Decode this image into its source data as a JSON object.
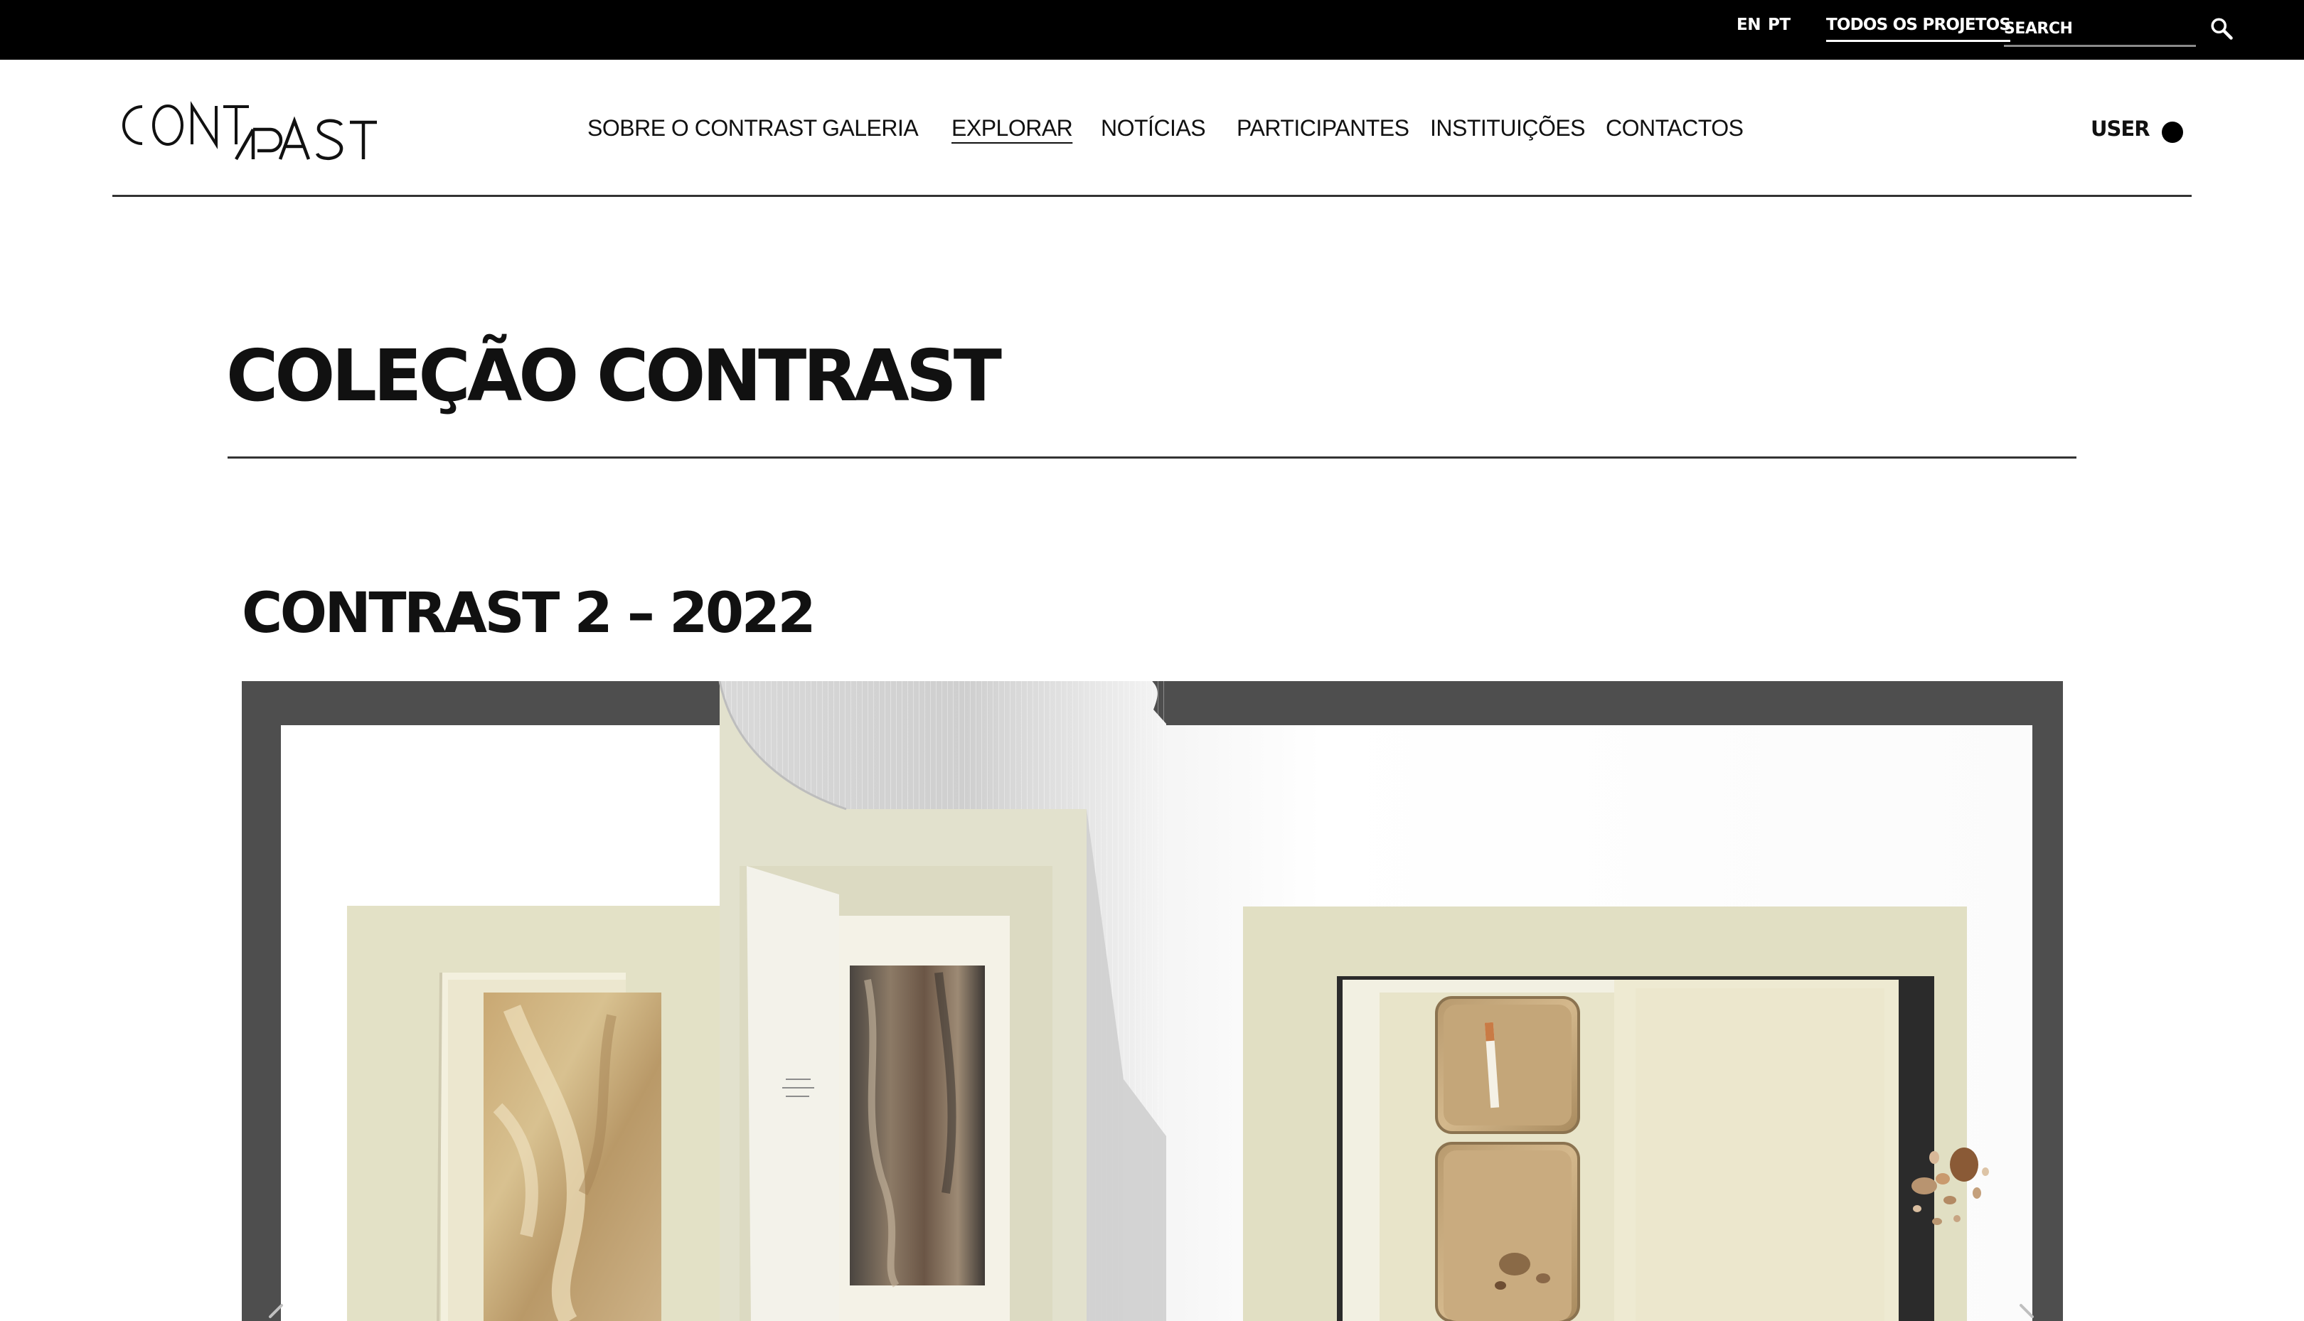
{
  "topbar": {
    "lang_en": "EN",
    "lang_pt": "PT",
    "all_projects": "TODOS OS PROJETOS",
    "search_placeholder": "SEARCH",
    "search_icon": "search-icon"
  },
  "header": {
    "logo_text": "CONTRAST",
    "nav": [
      {
        "label": "SOBRE O CONTRAST",
        "active": false
      },
      {
        "label": "GALERIA",
        "active": false
      },
      {
        "label": "EXPLORAR",
        "active": true
      },
      {
        "label": "NOTÍCIAS",
        "active": false
      },
      {
        "label": "PARTICIPANTES",
        "active": false
      },
      {
        "label": "INSTITUIÇÕES",
        "active": false
      },
      {
        "label": "CONTACTOS",
        "active": false
      }
    ],
    "user_label": "USER"
  },
  "main": {
    "page_title": "COLEÇÃO CONTRAST",
    "section_title": "CONTRAST 2 – 2022"
  },
  "viewer": {
    "prev_icon": "chevron-left-icon",
    "next_icon": "chevron-right-icon"
  },
  "colors": {
    "topbar_bg": "#000000",
    "viewer_bg": "#4e4e4e",
    "text": "#111111",
    "page_bg": "#ffffff"
  }
}
